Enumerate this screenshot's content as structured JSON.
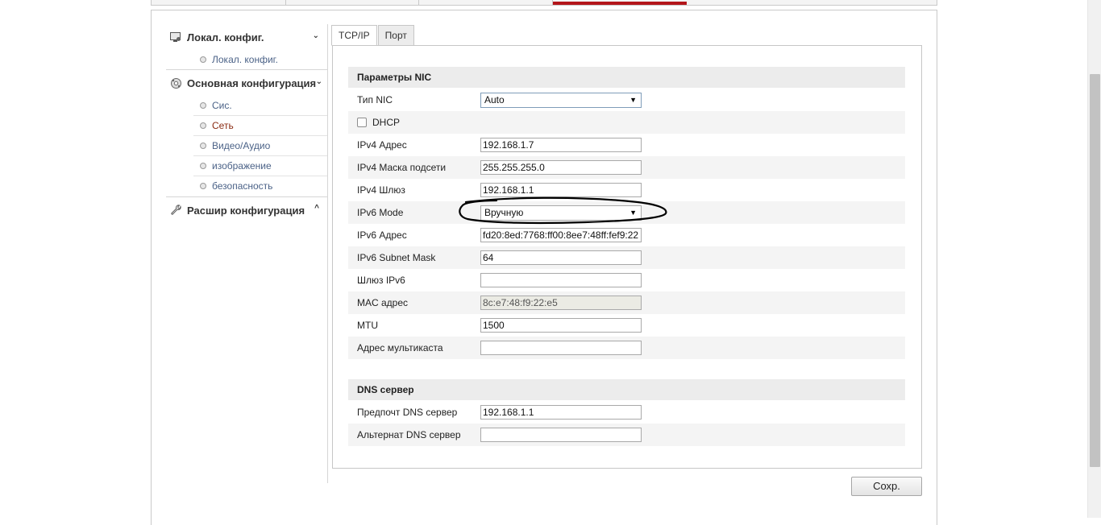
{
  "sidebar": {
    "groups": [
      {
        "label": "Локал. конфиг.",
        "icon": "monitor-settings-icon",
        "chevron": "⌄",
        "items": [
          {
            "label": "Локал. конфиг."
          }
        ]
      },
      {
        "label": "Основная конфигурация",
        "icon": "gear-cluster-icon",
        "chevron": "⌄",
        "items": [
          {
            "label": "Сис."
          },
          {
            "label": "Сеть",
            "active": true
          },
          {
            "label": "Видео/Аудио"
          },
          {
            "label": "изображение"
          },
          {
            "label": "безопасность"
          }
        ]
      },
      {
        "label": "Расшир конфигурация",
        "icon": "wrench-icon",
        "chevron": "^",
        "items": []
      }
    ]
  },
  "tabs": [
    {
      "label": "TCP/IP",
      "active": true
    },
    {
      "label": "Порт"
    }
  ],
  "nic": {
    "title": "Параметры NIC",
    "nic_type": {
      "label": "Тип NIC",
      "value": "Auto"
    },
    "dhcp": {
      "label": "DHCP",
      "checked": false
    },
    "ipv4_address": {
      "label": "IPv4 Адрес",
      "value": "192.168.1.7"
    },
    "ipv4_mask": {
      "label": "IPv4 Маска подсети",
      "value": "255.255.255.0"
    },
    "ipv4_gateway": {
      "label": "IPv4 Шлюз",
      "value": "192.168.1.1"
    },
    "ipv6_mode": {
      "label": "IPv6 Mode",
      "value": "Вручную"
    },
    "ipv6_address": {
      "label": "IPv6 Адрес",
      "value": "fd20:8ed:7768:ff00:8ee7:48ff:fef9:22"
    },
    "ipv6_mask": {
      "label": "IPv6 Subnet Mask",
      "value": "64"
    },
    "ipv6_gateway": {
      "label": "Шлюз IPv6",
      "value": ""
    },
    "mac": {
      "label": "MAC адрес",
      "value": "8c:e7:48:f9:22:e5"
    },
    "mtu": {
      "label": "MTU",
      "value": "1500"
    },
    "multicast": {
      "label": "Адрес мультикаста",
      "value": ""
    }
  },
  "dns": {
    "title": "DNS сервер",
    "preferred": {
      "label": "Предпочт DNS сервер",
      "value": "192.168.1.1"
    },
    "alternate": {
      "label": "Альтернат DNS сервер",
      "value": ""
    }
  },
  "actions": {
    "save_label": "Сохр."
  },
  "colors": {
    "accent_tab": "#b3161b",
    "active_menu": "#8a2b12",
    "menu_link": "#4b6287"
  },
  "select_arrow": "▼"
}
